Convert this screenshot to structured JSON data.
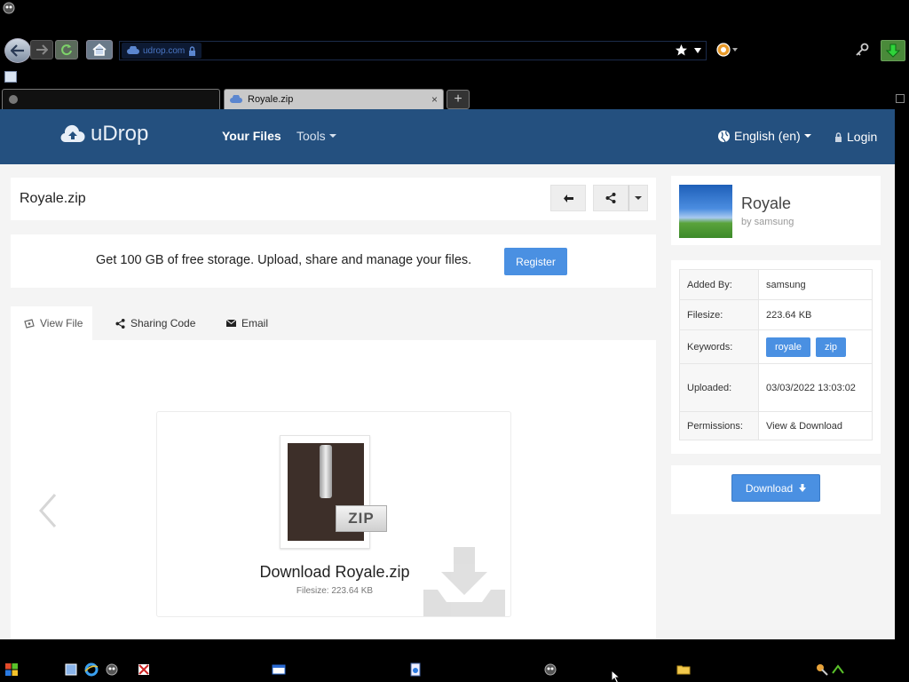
{
  "browser": {
    "url_domain": "udrop.com",
    "tabs": [
      {
        "label": "",
        "active": false
      },
      {
        "label": "Royale.zip",
        "active": true
      }
    ],
    "new_tab_symbol": "+",
    "close_symbol": "×"
  },
  "site": {
    "brand": "uDrop",
    "nav": {
      "your_files": "Your Files",
      "tools": "Tools",
      "language": "English (en)",
      "login": "Login"
    },
    "accent_color": "#24507f",
    "button_color": "#4a90e2"
  },
  "file": {
    "title": "Royale.zip",
    "promo_text": "Get 100 GB of free storage. Upload, share and manage your files.",
    "register_label": "Register",
    "tabs": [
      "View File",
      "Sharing Code",
      "Email"
    ],
    "zip_badge": "ZIP",
    "download_heading": "Download Royale.zip",
    "filesize_line": "Filesize: 223.64 KB"
  },
  "owner": {
    "name": "Royale",
    "by": "by samsung"
  },
  "info": {
    "added_by_label": "Added By:",
    "added_by": "samsung",
    "filesize_label": "Filesize:",
    "filesize": "223.64 KB",
    "keywords_label": "Keywords:",
    "keywords": [
      "royale",
      "zip"
    ],
    "uploaded_label": "Uploaded:",
    "uploaded": "03/03/2022 13:03:02",
    "permissions_label": "Permissions:",
    "permissions": "View & Download"
  },
  "download_button": "Download",
  "icons": {
    "nav": [
      "back-icon",
      "forward-icon",
      "reload-icon",
      "home-icon",
      "lock-icon",
      "star-icon",
      "key-icon",
      "download-arrow-icon"
    ],
    "page": [
      "cloud-upload-icon",
      "globe-icon",
      "lock-icon",
      "arrow-left-icon",
      "share-icon",
      "eye-icon",
      "envelope-icon",
      "chevron-left-icon"
    ]
  }
}
